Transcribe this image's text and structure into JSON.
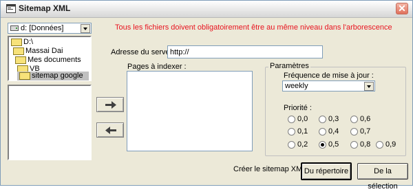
{
  "window": {
    "title": "Sitemap XML",
    "close_symbol": "✕"
  },
  "drive": {
    "selected": "d: [Données]"
  },
  "tree": {
    "items": [
      {
        "label": "D:\\"
      },
      {
        "label": "Massai Dai"
      },
      {
        "label": "Mes documents"
      },
      {
        "label": "VB"
      },
      {
        "label": "sitemap google"
      }
    ]
  },
  "notice": "Tous les fichiers doivent obligatoirement être au même niveau dans l'arborescence",
  "server": {
    "label": "Adresse du serveur :",
    "value": "http://"
  },
  "pages": {
    "label": "Pages à indexer :"
  },
  "params": {
    "title": "Paramètres",
    "frequency_label": "Fréquence de mise à jour :",
    "frequency_value": "weekly",
    "priority_label": "Priorité :",
    "priorities": [
      "0,0",
      "0,3",
      "0,6",
      "0,1",
      "0,4",
      "0,7",
      "0,2",
      "0,5",
      "0,8",
      "0,9"
    ],
    "selected_priority": "0,5"
  },
  "create": {
    "label": "Créer le sitemap XML :",
    "from_dir": "Du répertoire",
    "from_selection": "De la sélection"
  },
  "colors": {
    "notice": "#e8131f",
    "selection": "#c0c0c0"
  }
}
